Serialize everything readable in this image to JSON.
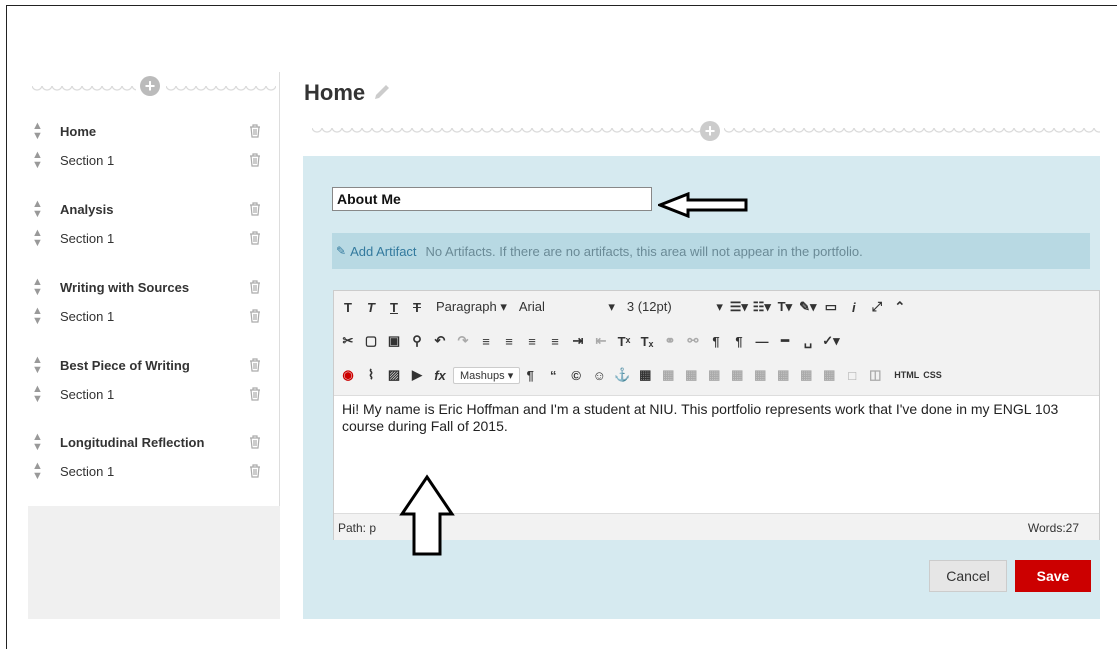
{
  "sidebar": {
    "items": [
      {
        "label": "Home",
        "type": "page"
      },
      {
        "label": "Section 1",
        "type": "section"
      },
      {
        "label": "Analysis",
        "type": "page"
      },
      {
        "label": "Section 1",
        "type": "section"
      },
      {
        "label": "Writing with Sources",
        "type": "page"
      },
      {
        "label": "Section 1",
        "type": "section"
      },
      {
        "label": "Best Piece of Writing",
        "type": "page"
      },
      {
        "label": "Section 1",
        "type": "section"
      },
      {
        "label": "Longitudinal Reflection",
        "type": "page"
      },
      {
        "label": "Section 1",
        "type": "section"
      }
    ]
  },
  "main": {
    "page_title": "Home",
    "section_title_value": "About Me",
    "artifact_link": "Add Artifact",
    "artifact_note": "No Artifacts. If there are no artifacts, this area will not appear in the portfolio.",
    "toolbar": {
      "format": "Paragraph",
      "font": "Arial",
      "size": "3 (12pt)",
      "mashups": "Mashups",
      "html": "HTML",
      "css": "CSS"
    },
    "body_text": "Hi! My name is Eric Hoffman and I'm a student at NIU. This portfolio represents work that I've done in my ENGL 103 course during Fall of 2015.",
    "path_label": "Path: p",
    "word_count": "Words:27"
  },
  "actions": {
    "cancel": "Cancel",
    "save": "Save"
  },
  "colors": {
    "panel": "#d6eaf0",
    "artifact_bar": "#b8d9e3",
    "save": "#cc0000"
  }
}
